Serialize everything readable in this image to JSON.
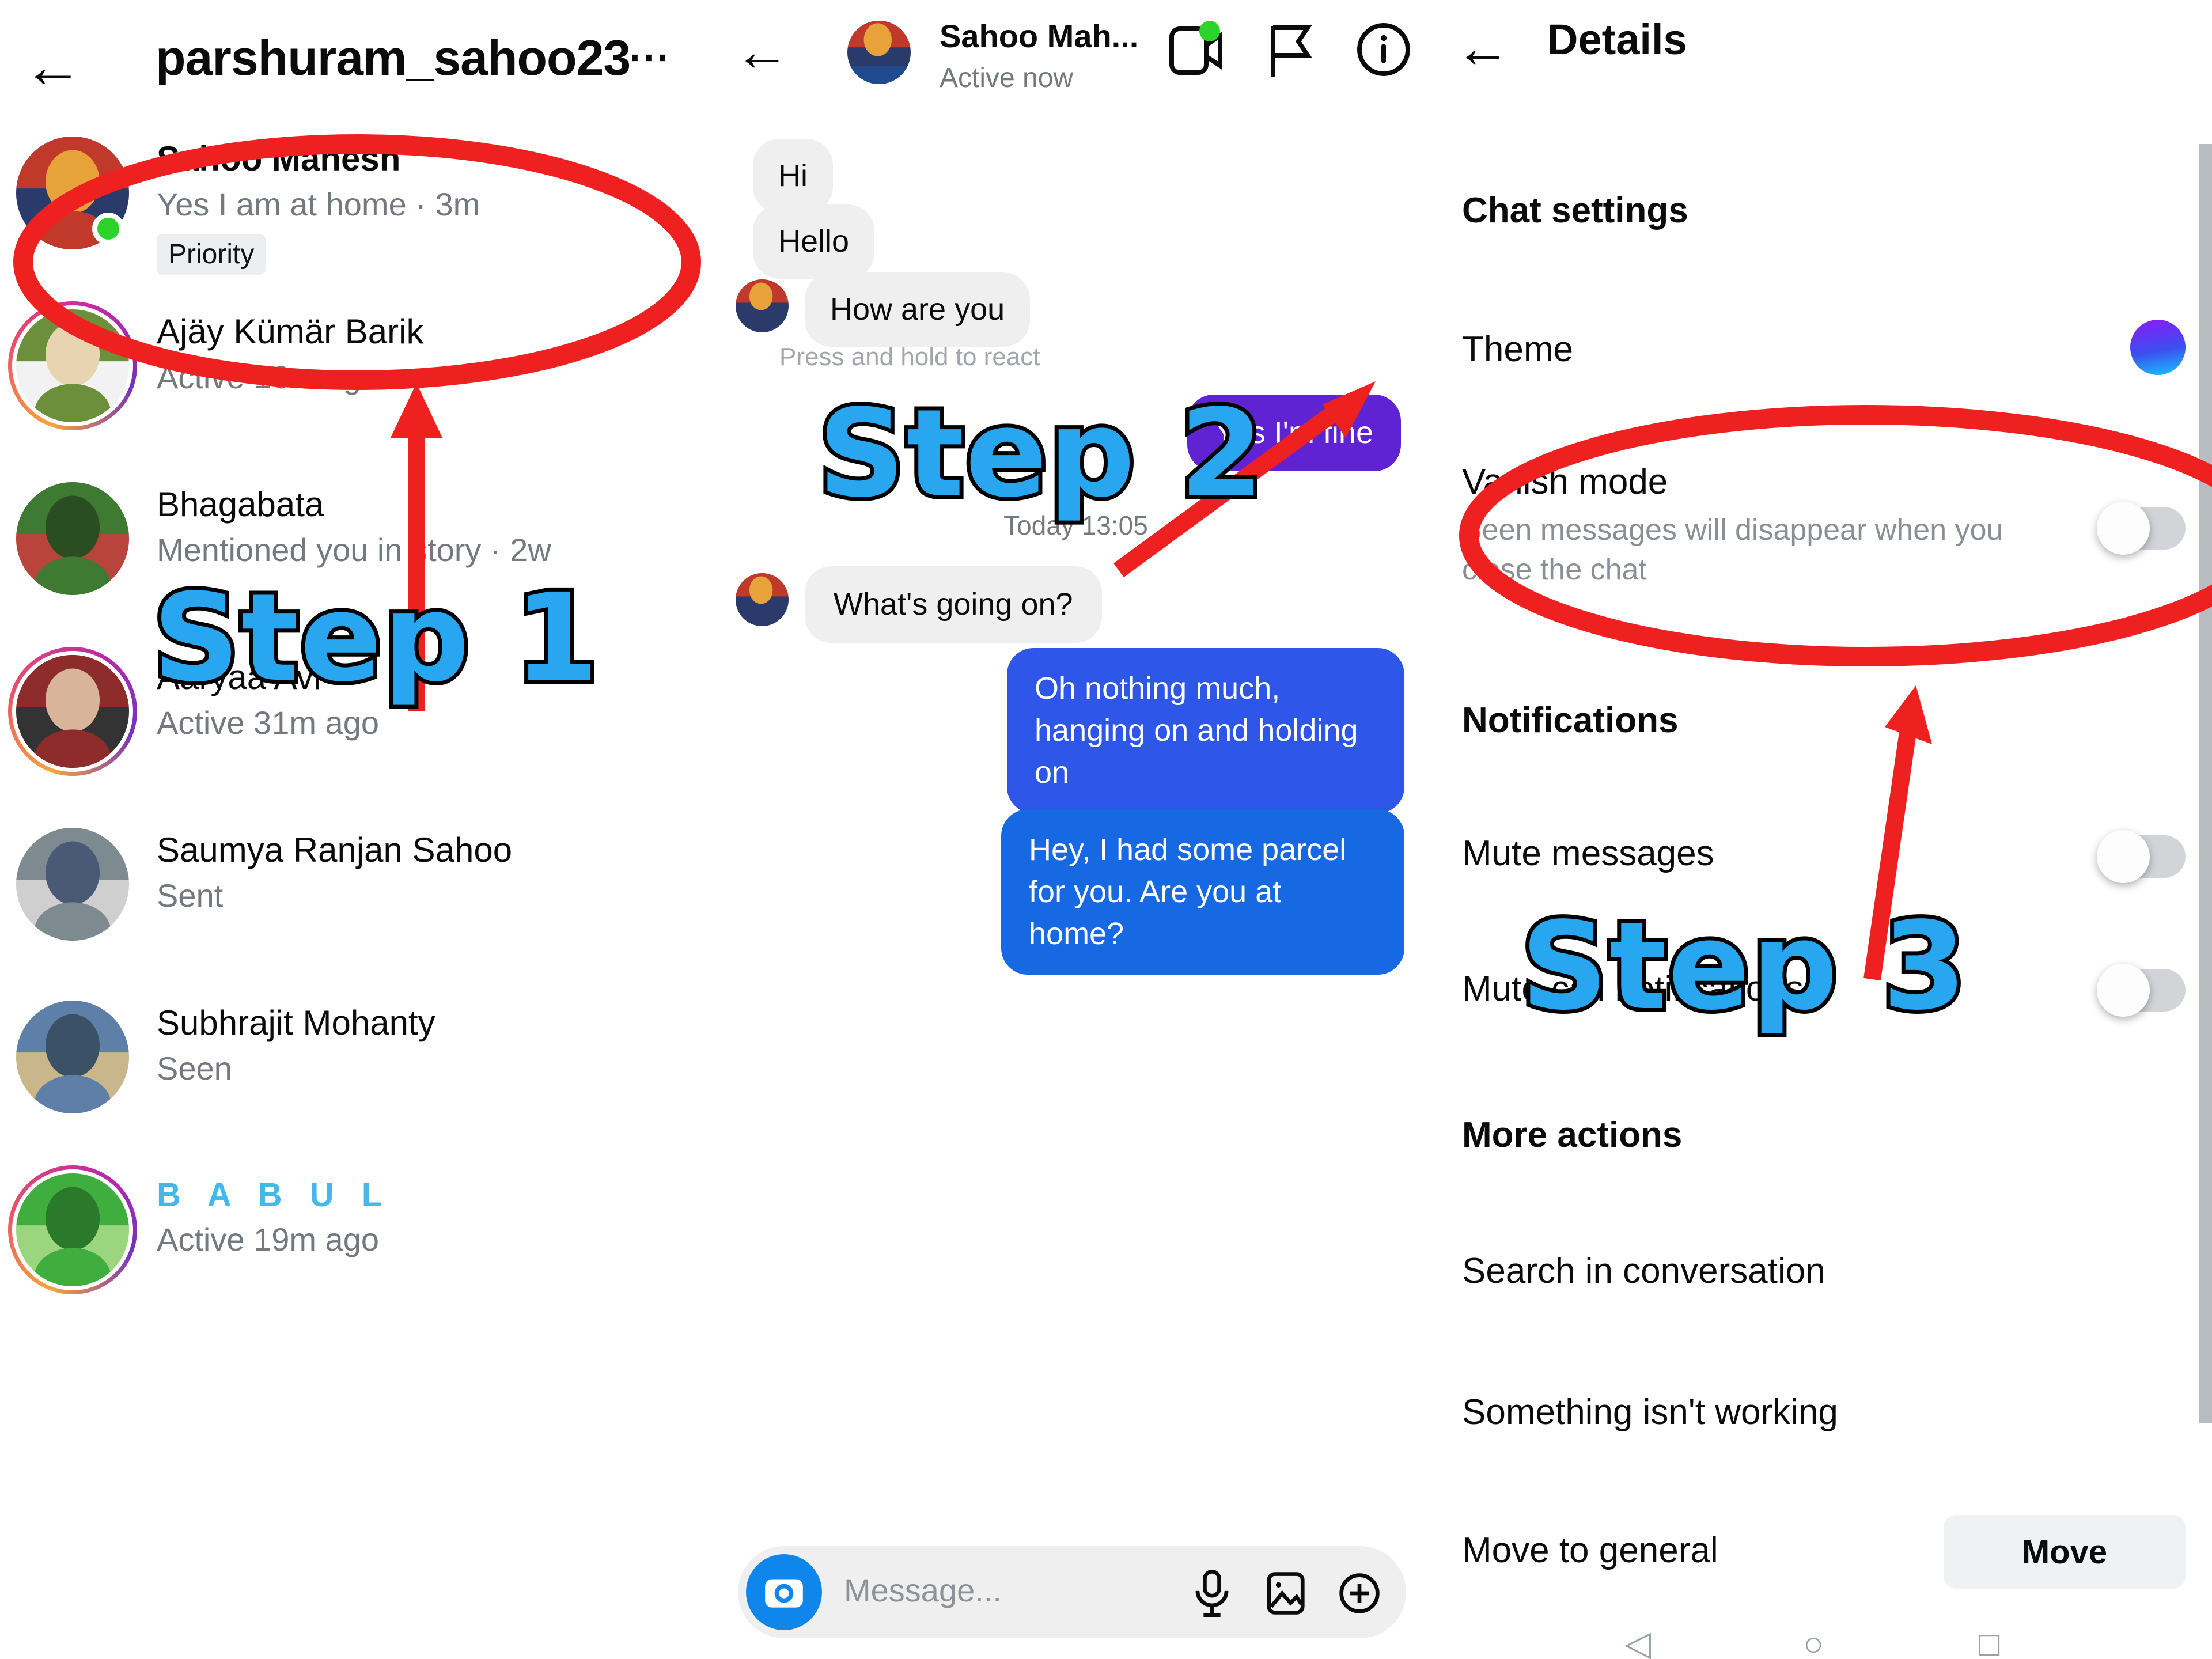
{
  "left_panel": {
    "back_icon": "back-arrow-icon",
    "title": "parshuram_sahoo23",
    "more_icon": "more-options-icon",
    "chats": [
      {
        "name": "Sahoo Mahesh",
        "subtitle": "Yes I am at home · 3m",
        "badge": "Priority",
        "online": true,
        "ring": false,
        "highlight": true
      },
      {
        "name": "Ajäy Kümär Barik",
        "subtitle": "Active 16m ago",
        "badge": "",
        "online": false,
        "ring": true,
        "highlight": false
      },
      {
        "name": "Bhagabata",
        "subtitle": "Mentioned you in story · 2w",
        "badge": "",
        "online": false,
        "ring": false,
        "highlight": false
      },
      {
        "name": "Aaryaa Avi",
        "subtitle": "Active 31m ago",
        "badge": "",
        "online": false,
        "ring": true,
        "highlight": false
      },
      {
        "name": "Saumya Ranjan Sahoo",
        "subtitle": "Sent",
        "badge": "",
        "online": false,
        "ring": false,
        "highlight": false
      },
      {
        "name": "Subhrajit Mohanty",
        "subtitle": "Seen",
        "badge": "",
        "online": false,
        "ring": false,
        "highlight": false
      },
      {
        "name": "B A B U L",
        "subtitle": "Active 19m ago",
        "badge": "",
        "online": false,
        "ring": true,
        "highlight": false
      }
    ]
  },
  "mid_panel": {
    "back_icon": "back-arrow-icon",
    "title": "Sahoo Mah...",
    "status": "Active now",
    "icons": [
      "video-call-icon",
      "flag-icon",
      "info-icon"
    ],
    "messages": [
      {
        "text": "Hi",
        "side": "in",
        "avatar": false
      },
      {
        "text": "Hello",
        "side": "in",
        "avatar": false
      },
      {
        "text": "How are you",
        "side": "in",
        "avatar": true
      },
      {
        "text": "Yes I'm fine",
        "side": "out",
        "avatar": false
      },
      {
        "text": "What's going on?",
        "side": "in",
        "avatar": true
      },
      {
        "text": "Oh nothing much, hanging on and holding on",
        "side": "out",
        "avatar": false
      },
      {
        "text": "Hey, I had some parcel for you. Are you at home?",
        "side": "out",
        "avatar": false
      }
    ],
    "react_hint": "Press and hold to react",
    "day_divider": "Today 13:05",
    "composer": {
      "camera_icon": "camera-icon",
      "placeholder": "Message...",
      "icons": [
        "microphone-icon",
        "gallery-icon",
        "plus-icon"
      ]
    },
    "colors": {
      "bubble_purple": "#6023d3",
      "bubble_blue": "#2e56e8",
      "bubble_blue_light": "#1668e3"
    }
  },
  "right_panel": {
    "back_icon": "back-arrow-icon",
    "title": "Details",
    "sections": [
      {
        "heading": "Chat settings",
        "items": [
          {
            "label": "Theme",
            "desc": "",
            "control": "theme-swatch"
          },
          {
            "label": "Vanish mode",
            "desc": "Seen messages will disappear when you close the chat",
            "control": "toggle-off"
          }
        ]
      },
      {
        "heading": "Notifications",
        "items": [
          {
            "label": "Mute messages",
            "desc": "",
            "control": "toggle-off"
          },
          {
            "label": "Mute call notifications",
            "desc": "",
            "control": "toggle-off"
          }
        ]
      },
      {
        "heading": "More actions",
        "items": [
          {
            "label": "Search in conversation",
            "desc": "",
            "control": "none"
          },
          {
            "label": "Something isn't working",
            "desc": "",
            "control": "none"
          },
          {
            "label": "Move to general",
            "desc": "",
            "control": "move-button"
          }
        ]
      }
    ],
    "move_button_label": "Move",
    "theme_color": "#6b2cf5"
  },
  "annotations": {
    "step1": "Step 1",
    "step2": "Step 2",
    "step3": "Step 3",
    "marker_color": "#ef2020"
  },
  "navbar": {
    "items": [
      "back-triangle-icon",
      "home-circle-icon",
      "recents-square-icon"
    ]
  }
}
